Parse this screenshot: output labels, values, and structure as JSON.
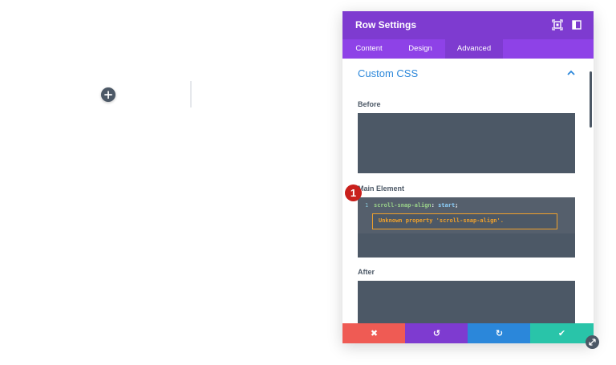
{
  "canvas": {
    "add_icon": "plus-icon",
    "add_symbol": "+"
  },
  "modal": {
    "title": "Row Settings",
    "header_icons": [
      "expand-icon",
      "sidebar-layout-icon"
    ],
    "tabs": [
      {
        "label": "Content",
        "active": false
      },
      {
        "label": "Design",
        "active": false
      },
      {
        "label": "Advanced",
        "active": true
      }
    ],
    "section": {
      "title": "Custom CSS",
      "collapse_icon": "chevron-up-icon",
      "fields": {
        "before": {
          "label": "Before",
          "value": ""
        },
        "main": {
          "label": "Main Element",
          "line_number": "1",
          "code_property": "scroll-snap-align",
          "code_colon": ":",
          "code_value": "start",
          "code_semicolon": ";",
          "error": "Unknown property 'scroll-snap-align'."
        },
        "after": {
          "label": "After",
          "value": ""
        }
      }
    },
    "footer": {
      "cancel_symbol": "✖",
      "undo_symbol": "↺",
      "redo_symbol": "↻",
      "save_symbol": "✔"
    }
  },
  "annotation": {
    "badge_number": "1"
  },
  "colors": {
    "header_purple": "#7e3bd0",
    "tab_purple": "#8e42e7",
    "accent_blue": "#2b87da",
    "cancel_red": "#ef5b54",
    "save_green": "#29c4a9",
    "code_bg": "#4c5866",
    "error_orange": "#f0a12b",
    "badge_red": "#c9201c"
  },
  "resize_handle_icon": "resize-diagonal-icon"
}
